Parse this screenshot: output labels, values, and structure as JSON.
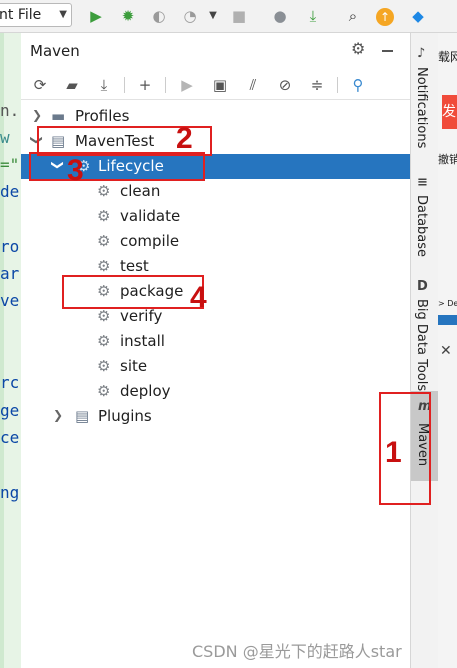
{
  "toolbar": {
    "run_config_label": "nt File",
    "icons": [
      "run-icon",
      "debug-icon",
      "coverage-icon",
      "profile-icon",
      "stop-icon",
      "account-icon",
      "update-icon",
      "search-icon",
      "plugin-update-icon",
      "toolbox-icon"
    ]
  },
  "editor_fragments": [
    "n.",
    "w",
    "=\"",
    "de",
    "ro",
    "ar",
    "ve",
    "rc",
    "ge",
    "ce",
    "ng"
  ],
  "maven_panel": {
    "title": "Maven",
    "toolbar_icons": [
      "reload-icon",
      "add-folder-icon",
      "download-icon",
      "add-icon",
      "run-icon",
      "execute-goal-icon",
      "toggle-offline-icon",
      "skip-tests-icon",
      "collapse-icon",
      "analyze-icon"
    ],
    "tree": {
      "profiles": "Profiles",
      "project": "MavenTest",
      "lifecycle": "Lifecycle",
      "phases": [
        "clean",
        "validate",
        "compile",
        "test",
        "package",
        "verify",
        "install",
        "site",
        "deploy"
      ],
      "plugins": "Plugins"
    }
  },
  "right_tabs": {
    "notifications": "Notifications",
    "database": "Database",
    "big_data_tools": "Big Data Tools",
    "maven": "Maven"
  },
  "far_right": {
    "frag1": "载网",
    "frag2": "发",
    "frag3": "撤销",
    "frag4": "> Dep"
  },
  "annotations": [
    "1",
    "2",
    "3",
    "4"
  ],
  "watermark": "CSDN @星光下的赶路人star",
  "colors": {
    "selection": "#2675bf",
    "annotation": "#e02020",
    "run_green": "#3c9d3c"
  }
}
